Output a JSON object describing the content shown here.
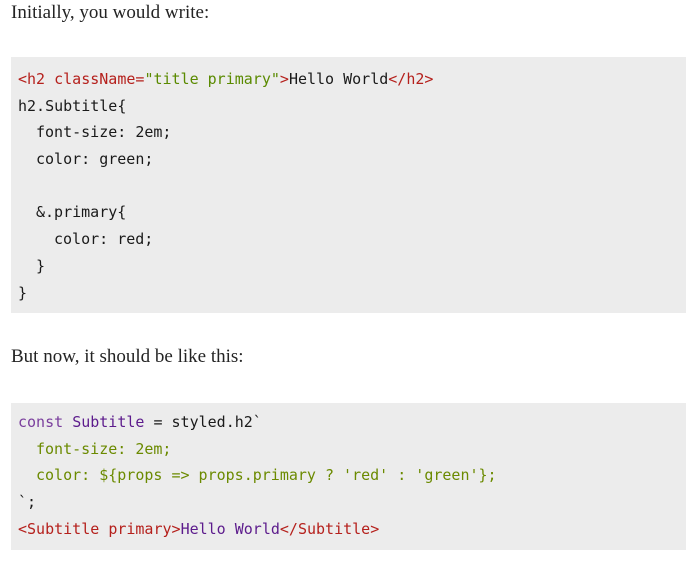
{
  "paragraphs": {
    "intro": "Initially, you would write:",
    "transition": "But now, it should be like this:"
  },
  "code_block_1": {
    "line1": {
      "open_tag": "<h2 ",
      "attr": "className=",
      "value": "\"title primary\"",
      "close_bracket": ">",
      "text": "Hello World",
      "end_tag": "</h2>"
    },
    "line2": "h2.Subtitle{",
    "line3": "font-size: 2em;",
    "line4": "color: green;",
    "line5": "",
    "line6": "&.primary{",
    "line7": "color: red;",
    "line8": "}",
    "line9": "}"
  },
  "code_block_2": {
    "line1": {
      "keyword": "const",
      "name": "Subtitle",
      "rest": " = styled.h2`"
    },
    "line2": "font-size: 2em;",
    "line3": "color: ${props => props.primary ? 'red' : 'green'};",
    "line4": "`;",
    "line5": {
      "open_tag": "<Subtitle ",
      "attr": "primary",
      "close_bracket": ">",
      "text": "Hello World",
      "end_tag": "</Subtitle>"
    }
  }
}
